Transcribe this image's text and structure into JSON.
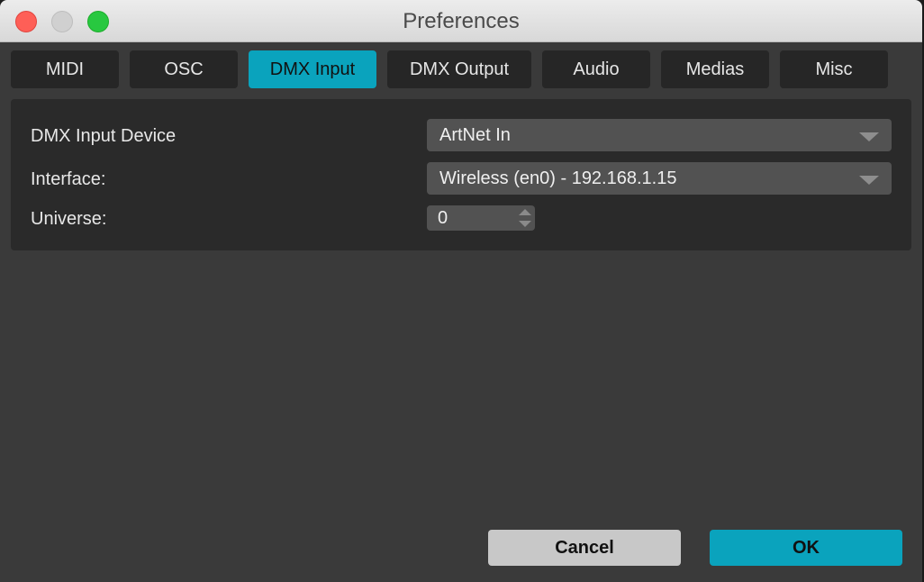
{
  "window": {
    "title": "Preferences"
  },
  "tabs": [
    {
      "label": "MIDI"
    },
    {
      "label": "OSC"
    },
    {
      "label": "DMX Input",
      "active": true
    },
    {
      "label": "DMX Output"
    },
    {
      "label": "Audio"
    },
    {
      "label": "Medias"
    },
    {
      "label": "Misc"
    }
  ],
  "dmx_input": {
    "device": {
      "label": "DMX Input Device",
      "value": "ArtNet In"
    },
    "interface": {
      "label": "Interface:",
      "value": "Wireless (en0) - 192.168.1.15"
    },
    "universe": {
      "label": "Universe:",
      "value": "0"
    }
  },
  "buttons": {
    "cancel": "Cancel",
    "ok": "OK"
  },
  "colors": {
    "accent": "#0aa3bd",
    "background": "#3a3a3a",
    "panel": "#2a2a2a"
  }
}
